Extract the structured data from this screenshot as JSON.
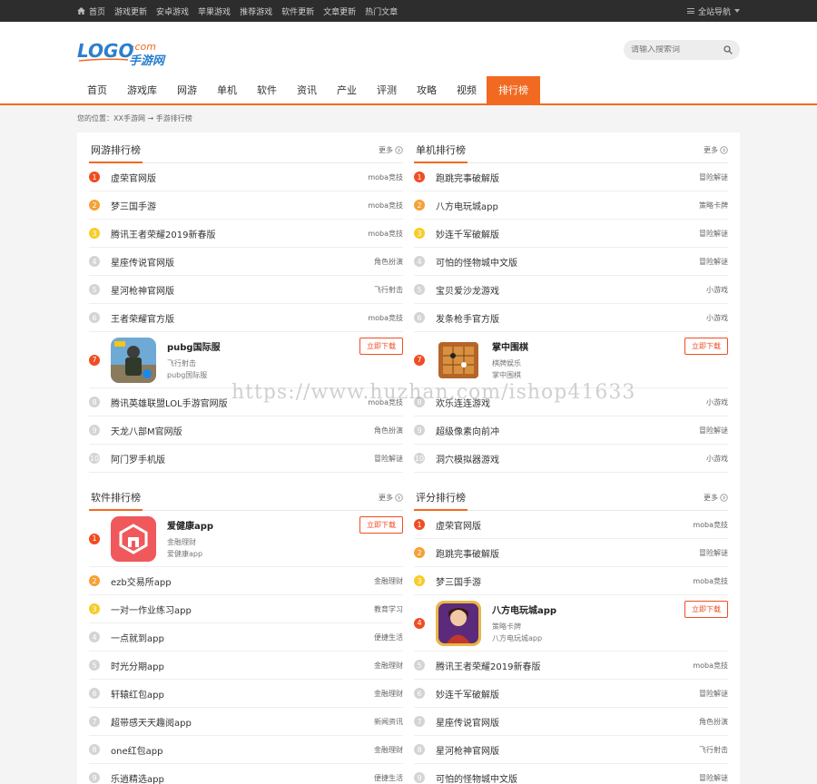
{
  "topbar": {
    "links": [
      "首页",
      "游戏更新",
      "安卓游戏",
      "苹果游戏",
      "推荐游戏",
      "软件更新",
      "文章更新",
      "热门文章"
    ],
    "site_nav": "全站导航"
  },
  "header": {
    "logo_text": "LOGO·com 手游网",
    "search_placeholder": "请输入搜索词"
  },
  "nav": {
    "items": [
      "首页",
      "游戏库",
      "网游",
      "单机",
      "软件",
      "资讯",
      "产业",
      "评测",
      "攻略",
      "视频",
      "排行榜"
    ],
    "active_index": 10
  },
  "breadcrumb": "您的位置：XX手游网 → 手游排行榜",
  "more_label": "更多",
  "download_label": "立即下载",
  "panels": {
    "online": {
      "title": "网游排行榜",
      "rows": [
        {
          "rank": "1",
          "name": "虚荣官网版",
          "tag": "moba竞技"
        },
        {
          "rank": "2",
          "name": "梦三国手游",
          "tag": "moba竞技"
        },
        {
          "rank": "3",
          "name": "腾讯王者荣耀2019新春版",
          "tag": "moba竞技"
        },
        {
          "rank": "4",
          "name": "星座传说官网版",
          "tag": "角色扮演"
        },
        {
          "rank": "5",
          "name": "星河枪神官网版",
          "tag": "飞行射击"
        },
        {
          "rank": "6",
          "name": "王者荣耀官方版",
          "tag": "moba竞技"
        }
      ],
      "feature": {
        "rank": "7",
        "name": "pubg国际服",
        "genre": "飞行射击",
        "sub": "pubg国际服"
      },
      "rows2": [
        {
          "rank": "8",
          "name": "腾讯英雄联盟LOL手游官网版",
          "tag": "moba竞技"
        },
        {
          "rank": "9",
          "name": "天龙八部M官网版",
          "tag": "角色扮演"
        },
        {
          "rank": "10",
          "name": "阿门罗手机版",
          "tag": "冒险解谜"
        }
      ]
    },
    "single": {
      "title": "单机排行榜",
      "rows": [
        {
          "rank": "1",
          "name": "跑跳完事破解版",
          "tag": "冒险解谜"
        },
        {
          "rank": "2",
          "name": "八方电玩城app",
          "tag": "策略卡牌"
        },
        {
          "rank": "3",
          "name": "妙连千军破解版",
          "tag": "冒险解谜"
        },
        {
          "rank": "4",
          "name": "可怕的怪物城中文版",
          "tag": "冒险解谜"
        },
        {
          "rank": "5",
          "name": "宝贝爱沙龙游戏",
          "tag": "小游戏"
        },
        {
          "rank": "6",
          "name": "发条枪手官方版",
          "tag": "小游戏"
        }
      ],
      "feature": {
        "rank": "7",
        "name": "掌中围棋",
        "genre": "棋牌娱乐",
        "sub": "掌中围棋"
      },
      "rows2": [
        {
          "rank": "8",
          "name": "欢乐连连游戏",
          "tag": "小游戏"
        },
        {
          "rank": "9",
          "name": "超级像素向前冲",
          "tag": "冒险解谜"
        },
        {
          "rank": "10",
          "name": "洞穴模拟器游戏",
          "tag": "小游戏"
        }
      ]
    },
    "software": {
      "title": "软件排行榜",
      "feature": {
        "rank": "1",
        "name": "爱健康app",
        "genre": "金融理财",
        "sub": "爱健康app"
      },
      "rows": [
        {
          "rank": "2",
          "name": "ezb交易所app",
          "tag": "金融理财"
        },
        {
          "rank": "3",
          "name": "一对一作业练习app",
          "tag": "教育学习"
        },
        {
          "rank": "4",
          "name": "一点就到app",
          "tag": "便捷生活"
        },
        {
          "rank": "5",
          "name": "时光分期app",
          "tag": "金融理财"
        },
        {
          "rank": "6",
          "name": "轩辕红包app",
          "tag": "金融理财"
        },
        {
          "rank": "7",
          "name": "超带感天天趣阅app",
          "tag": "新闻资讯"
        },
        {
          "rank": "8",
          "name": "one红包app",
          "tag": "金融理财"
        },
        {
          "rank": "9",
          "name": "乐逍精选app",
          "tag": "便捷生活"
        }
      ]
    },
    "rating": {
      "title": "评分排行榜",
      "rows": [
        {
          "rank": "1",
          "name": "虚荣官网版",
          "tag": "moba竞技"
        },
        {
          "rank": "2",
          "name": "跑跳完事破解版",
          "tag": "冒险解谜"
        },
        {
          "rank": "3",
          "name": "梦三国手游",
          "tag": "moba竞技"
        }
      ],
      "feature": {
        "rank": "4",
        "name": "八方电玩城app",
        "genre": "策略卡牌",
        "sub": "八方电玩城app"
      },
      "rows2": [
        {
          "rank": "5",
          "name": "腾讯王者荣耀2019新春版",
          "tag": "moba竞技"
        },
        {
          "rank": "6",
          "name": "妙连千军破解版",
          "tag": "冒险解谜"
        },
        {
          "rank": "7",
          "name": "星座传说官网版",
          "tag": "角色扮演"
        },
        {
          "rank": "8",
          "name": "星河枪神官网版",
          "tag": "飞行射击"
        },
        {
          "rank": "9",
          "name": "可怕的怪物城中文版",
          "tag": "冒险解谜"
        }
      ]
    }
  },
  "watermark": "https://www.huzhan.com/ishop41633",
  "colors": {
    "accent": "#f26a21",
    "rank1": "#f04c23",
    "rank2": "#f7a035",
    "rank3": "#f8cc28",
    "rank_other": "#d4d4d4"
  }
}
